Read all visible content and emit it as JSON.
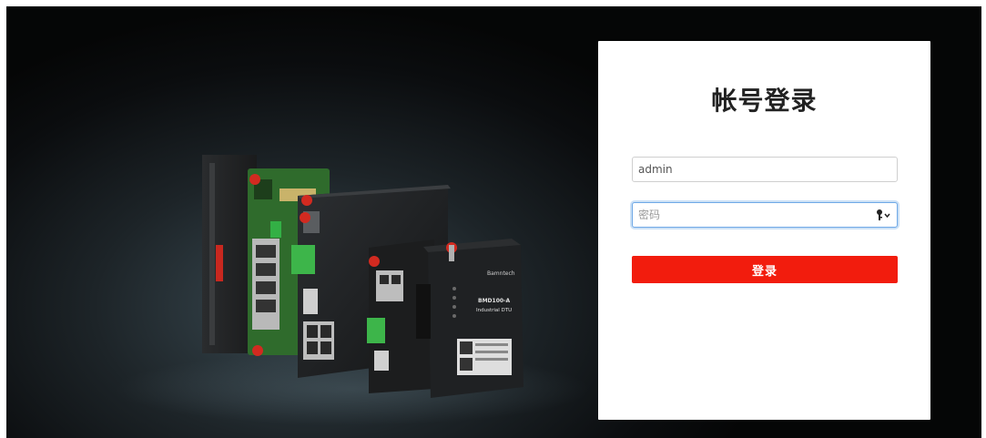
{
  "login": {
    "title": "帐号登录",
    "username_value": "admin",
    "password_placeholder": "密码",
    "submit_label": "登录"
  },
  "hero": {
    "device_brand": "Bamntech",
    "device_model": "BMD100-A",
    "device_line": "Industrial DTU"
  },
  "colors": {
    "accent": "#f21c0d",
    "background": "#0b0d0f",
    "card": "#ffffff",
    "focus_border": "#6ea8e6"
  },
  "icons": {
    "password_manager": "key-dropdown-icon"
  }
}
